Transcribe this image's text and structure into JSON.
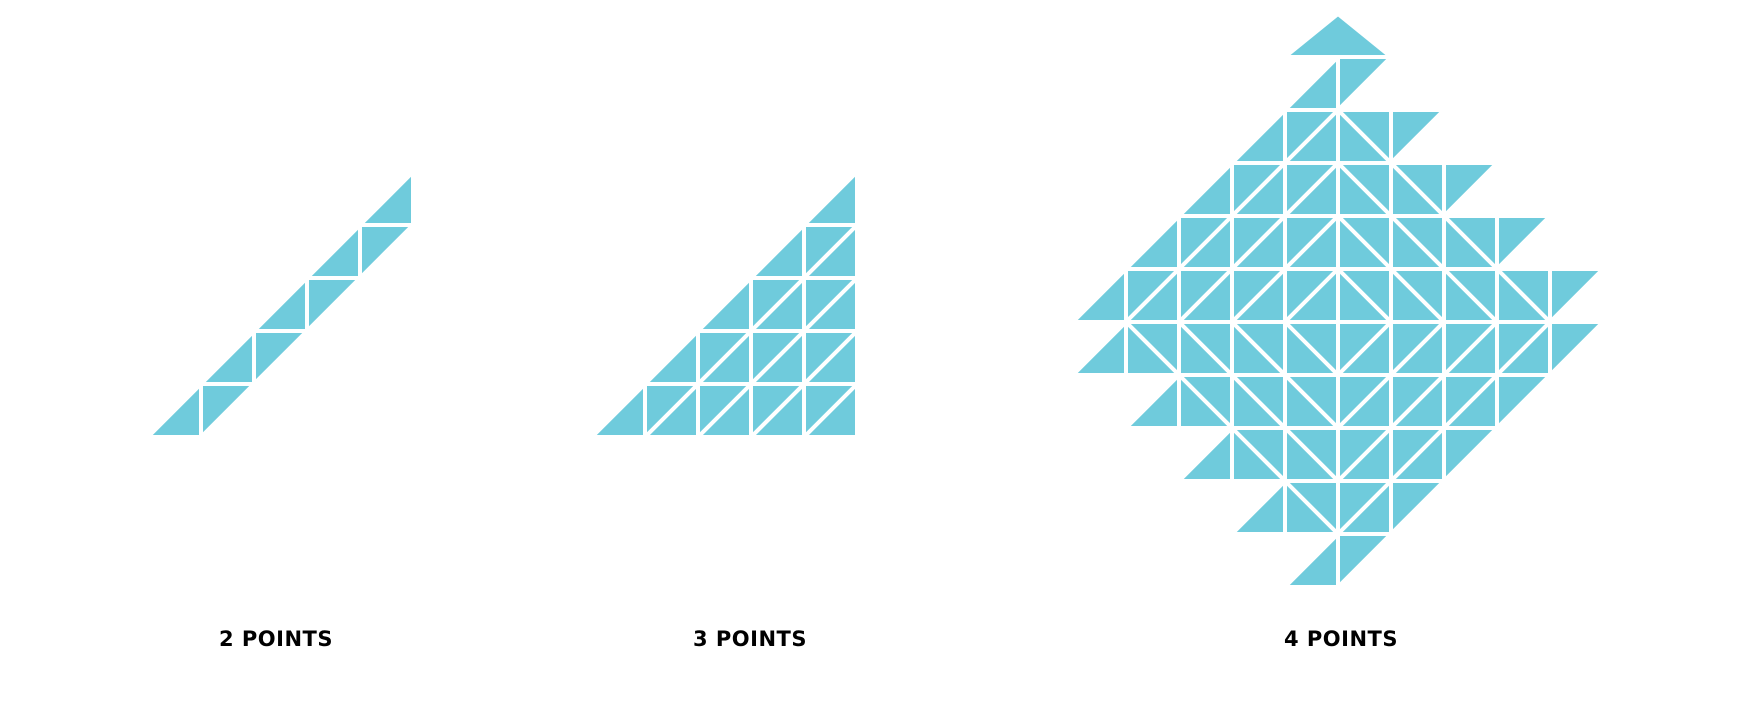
{
  "fill_color": "#6fcbdc",
  "line_color": "#ffffff",
  "figures": [
    {
      "label": "2 POINTS"
    },
    {
      "label": "3 POINTS"
    },
    {
      "label": "4 POINTS"
    }
  ]
}
